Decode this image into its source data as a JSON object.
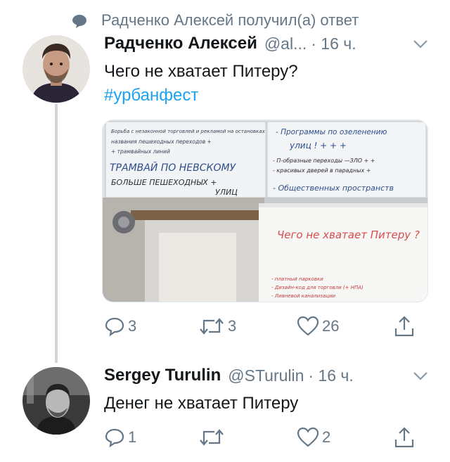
{
  "social_context": {
    "text": "Радченко Алексей получил(а) ответ",
    "icon": "reply-bubble-icon"
  },
  "tweets": [
    {
      "name": "Радченко Алексей",
      "handle": "@al...",
      "time": "· 16 ч.",
      "text": "Чего не хватает Питеру?",
      "hashtag": "#урбанфест",
      "actions": {
        "replies": "3",
        "retweets": "3",
        "likes": "26"
      },
      "media": {
        "left_board": [
          "Борьба с незаконной торговлей и рекламой на остановках",
          "названия пешеходных переходов +",
          "+ трамвайных линий",
          "ТРАМВАЙ ПО НЕВСКОМУ",
          "БОЛЬШЕ ПЕШЕХОДНЫХ +",
          "УЛИЦ"
        ],
        "right_board": [
          "- Программы по озеленению",
          "улиц ! + + +",
          "- П-образные переходы —ЗЛО + +",
          "- красивых дверей в парадных +",
          "- Общественных пространств"
        ],
        "poster_title": "Чего не хватает Питеру ?",
        "poster_notes": [
          "- платный парковки",
          "- Дизайн-код для торговли (+ НПА)",
          "- Ливневой канализации"
        ]
      }
    },
    {
      "name": "Sergey Turulin",
      "handle": "@STurulin",
      "time": "· 16 ч.",
      "text": "Денег не хватает Питеру",
      "actions": {
        "replies": "1",
        "retweets": "",
        "likes": "2"
      }
    }
  ],
  "colors": {
    "accent": "#1da1f2",
    "secondary": "#657786",
    "thread_line": "#ccd6dd"
  }
}
